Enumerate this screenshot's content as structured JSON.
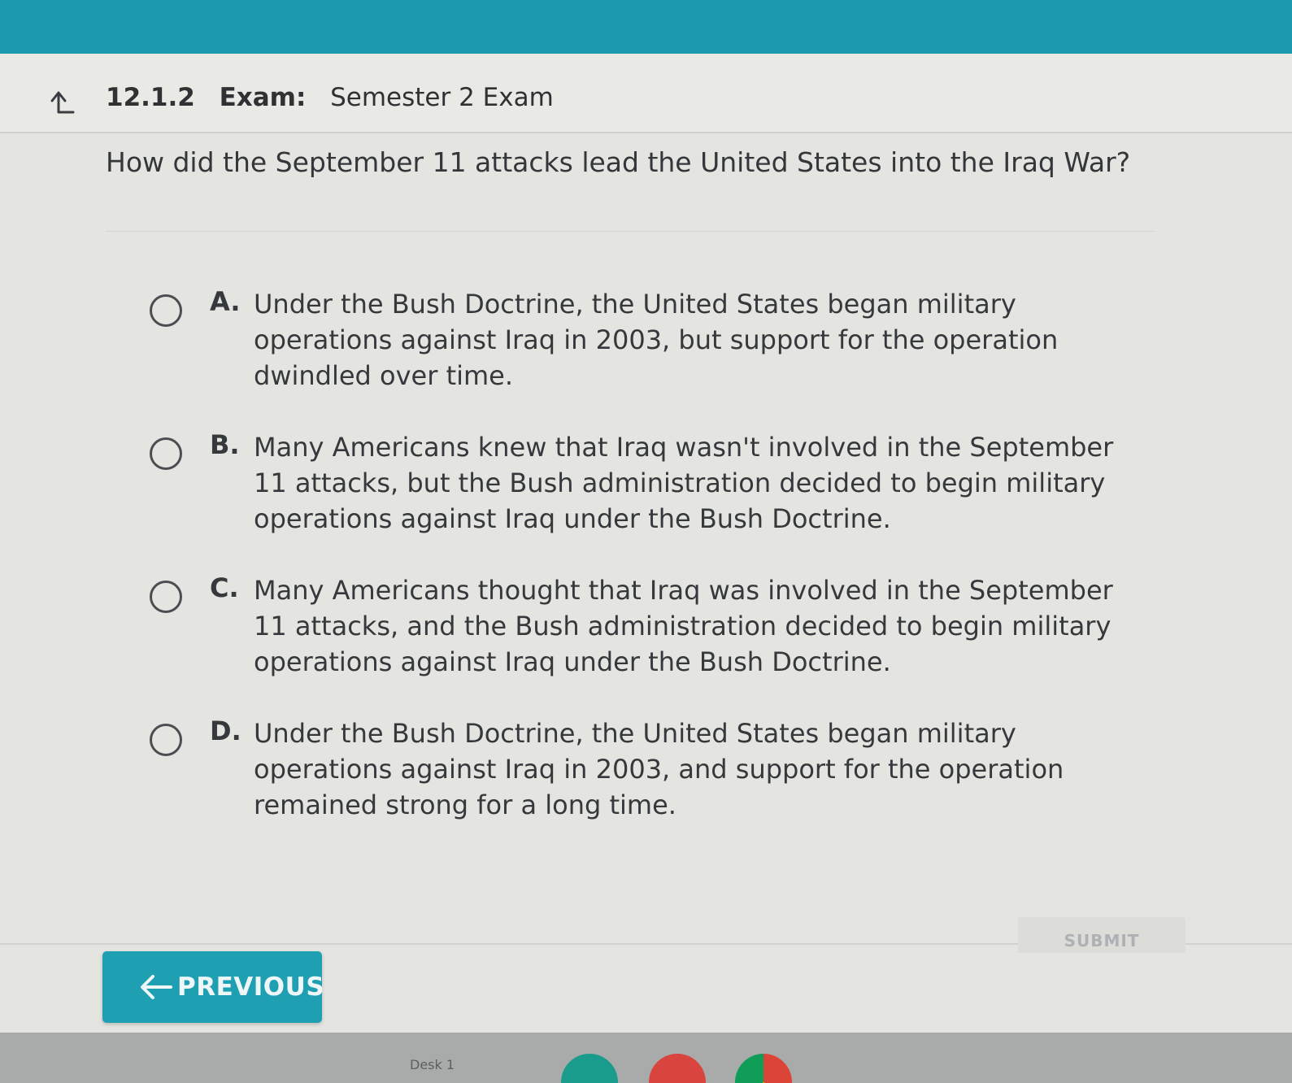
{
  "header": {
    "number": "12.1.2",
    "kind": "Exam:",
    "title": "Semester 2 Exam",
    "back_icon": "up-arrow-icon"
  },
  "question": {
    "text": "How did the September 11 attacks lead the United States into the Iraq War?"
  },
  "options": [
    {
      "letter": "A.",
      "text": "Under the Bush Doctrine, the United States began military operations against Iraq in 2003, but support for the operation dwindled over time.",
      "selected": false
    },
    {
      "letter": "B.",
      "text": "Many Americans knew that Iraq wasn't involved in the September 11 attacks, but the Bush administration decided to begin military operations against Iraq under the Bush Doctrine.",
      "selected": false
    },
    {
      "letter": "C.",
      "text": "Many Americans thought that Iraq was involved in the September 11 attacks, and the Bush administration decided to begin military operations against Iraq under the Bush Doctrine.",
      "selected": false
    },
    {
      "letter": "D.",
      "text": "Under the Bush Doctrine, the United States began military operations against Iraq in 2003, and support for the operation remained strong for a long time.",
      "selected": false
    }
  ],
  "footer": {
    "submit_label": "SUBMIT",
    "previous_label": "PREVIOUS",
    "previous_icon": "left-arrow-icon"
  },
  "taskbar": {
    "desk_label": "Desk 1"
  },
  "colors": {
    "accent": "#1e9fb2",
    "top_bar": "#1b99ad",
    "background": "#e4e4e1",
    "text": "#36393c"
  }
}
